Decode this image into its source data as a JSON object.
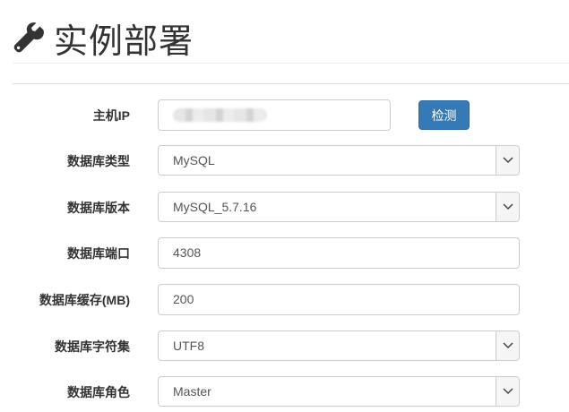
{
  "page": {
    "title": "实例部署"
  },
  "form": {
    "host_ip": {
      "label": "主机IP",
      "value": ""
    },
    "detect_button": "检测",
    "db_type": {
      "label": "数据库类型",
      "value": "MySQL"
    },
    "db_version": {
      "label": "数据库版本",
      "value": "MySQL_5.7.16"
    },
    "db_port": {
      "label": "数据库端口",
      "value": "4308"
    },
    "db_cache": {
      "label": "数据库缓存(MB)",
      "value": "200"
    },
    "db_charset": {
      "label": "数据库字符集",
      "value": "UTF8"
    },
    "db_role": {
      "label": "数据库角色",
      "value": "Master"
    }
  },
  "icons": {
    "header": "wrench-icon",
    "select": "chevron-down-icon"
  },
  "colors": {
    "primary": "#337ab7",
    "border": "#cccccc",
    "text": "#333333"
  }
}
